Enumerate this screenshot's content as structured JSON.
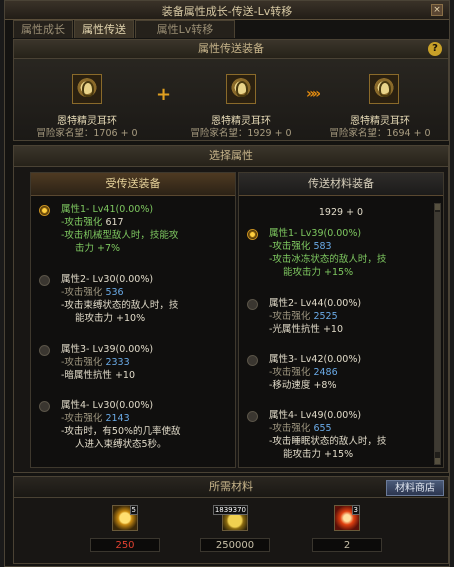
{
  "window": {
    "title": "装备属性成长-传送-Lv转移",
    "close_label": "×"
  },
  "tabs": [
    {
      "label": "属性成长"
    },
    {
      "label": "属性传送"
    },
    {
      "label": "属性Lv转移"
    }
  ],
  "transfer_section": {
    "title": "属性传送装备",
    "help_label": "?",
    "plus_label": "+",
    "arrow_label": "»»",
    "items": [
      {
        "name": "恩特精灵耳环",
        "fame": "冒险家名望：1706 + 0"
      },
      {
        "name": "恩特精灵耳环",
        "fame": "冒险家名望：1929 + 0"
      },
      {
        "name": "恩特精灵耳环",
        "fame": "冒险家名望：1694 + 0"
      }
    ]
  },
  "select_section": {
    "title": "选择属性",
    "left": {
      "header": "受传送装备",
      "entries": [
        {
          "title": "属性1- Lv41(0.00%)",
          "selected": true,
          "lines": [
            {
              "a": "-攻击强化 ",
              "b": "617"
            },
            {
              "a": "-攻击机械型敌人时，技能攻",
              "b": ""
            },
            {
              "a": "击力 +7%",
              "b": ""
            }
          ]
        },
        {
          "title": "属性2- Lv30(0.00%)",
          "selected": false,
          "lines": [
            {
              "a": "-攻击强化 ",
              "b": "536"
            },
            {
              "a": "-攻击束缚状态的敌人时，技",
              "b": ""
            },
            {
              "a": "能攻击力 +10%",
              "b": ""
            }
          ]
        },
        {
          "title": "属性3- Lv39(0.00%)",
          "selected": false,
          "lines": [
            {
              "a": "-攻击强化 ",
              "b": "2333"
            },
            {
              "a": "-暗属性抗性 +10",
              "b": ""
            }
          ]
        },
        {
          "title": "属性4- Lv30(0.00%)",
          "selected": false,
          "lines": [
            {
              "a": "-攻击强化 ",
              "b": "2143"
            },
            {
              "a": "-攻击时，有50%的几率使敌",
              "b": ""
            },
            {
              "a": "人进入束缚状态5秒。",
              "b": ""
            }
          ]
        }
      ]
    },
    "right": {
      "header": "传送材料装备",
      "fame": "1929 + 0",
      "entries": [
        {
          "title": "属性1- Lv39(0.00%)",
          "selected": true,
          "lines": [
            {
              "a": "-攻击强化 ",
              "b": "583"
            },
            {
              "a": "-攻击冰冻状态的敌人时，技",
              "b": ""
            },
            {
              "a": "能攻击力 +15%",
              "b": ""
            }
          ]
        },
        {
          "title": "属性2- Lv44(0.00%)",
          "selected": false,
          "lines": [
            {
              "a": "-攻击强化 ",
              "b": "2525"
            },
            {
              "a": "-光属性抗性 +10",
              "b": ""
            }
          ]
        },
        {
          "title": "属性3- Lv42(0.00%)",
          "selected": false,
          "lines": [
            {
              "a": "-攻击强化 ",
              "b": "2486"
            },
            {
              "a": "-移动速度 +8%",
              "b": ""
            }
          ]
        },
        {
          "title": "属性4- Lv49(0.00%)",
          "selected": false,
          "lines": [
            {
              "a": "-攻击强化 ",
              "b": "655"
            },
            {
              "a": "-攻击睡眠状态的敌人时，技",
              "b": ""
            },
            {
              "a": "能攻击力 +15%",
              "b": ""
            }
          ]
        }
      ]
    }
  },
  "materials": {
    "title": "所需材料",
    "shop_label": "材料商店",
    "items": [
      {
        "badge": "5",
        "qty": "250",
        "color": "#e04030"
      },
      {
        "badge": "1839370",
        "qty": "250000",
        "color": "#c8c0a8"
      },
      {
        "badge": "3",
        "qty": "2",
        "color": "#c8c0a8"
      }
    ]
  }
}
